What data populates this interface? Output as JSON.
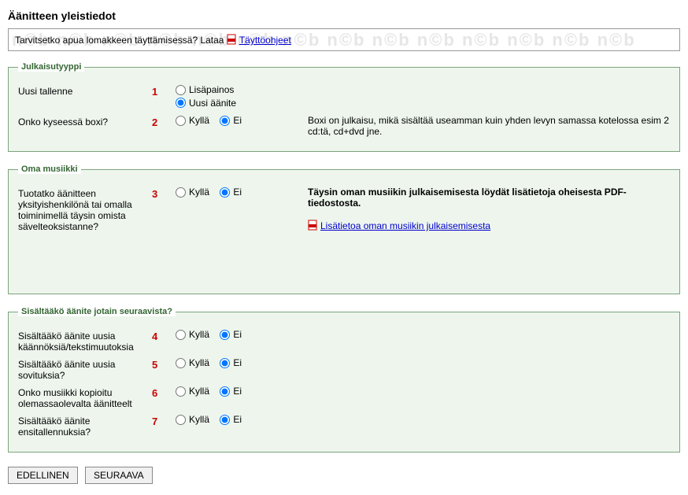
{
  "page_title": "Äänitteen yleistiedot",
  "help": {
    "prefix": "Tarvitsetko apua lomakkeen täyttämisessä? Lataa ",
    "link_label": "Täyttöohjeet",
    "watermark": "n©b n©b n©b n©b n©b n©b n©b n©b n©b n©b n©b n©b n©b n©b"
  },
  "sections": {
    "julkaisutyyppi": {
      "legend": "Julkaisutyyppi",
      "rows": [
        {
          "label": "Uusi tallenne",
          "num": "1",
          "options": [
            "Lisäpainos",
            "Uusi äänite"
          ],
          "selected": 1,
          "info": ""
        },
        {
          "label": "Onko kyseessä boxi?",
          "num": "2",
          "options": [
            "Kyllä",
            "Ei"
          ],
          "selected": 1,
          "info": "Boxi on julkaisu, mikä sisältää useamman kuin yhden levyn samassa kotelossa esim 2 cd:tä, cd+dvd jne."
        }
      ]
    },
    "oma_musiikki": {
      "legend": "Oma musiikki",
      "rows": [
        {
          "label": "Tuotatko äänitteen yksityishenkilönä tai omalla toiminimellä täysin omista sävelteoksistanne?",
          "num": "3",
          "options": [
            "Kyllä",
            "Ei"
          ],
          "selected": 1,
          "info_bold": "Täysin oman musiikin julkaisemisesta löydät lisätietoja oheisesta PDF-tiedostosta.",
          "link_label": "Lisätietoa oman musiikin julkaisemisesta"
        }
      ]
    },
    "sisaltaako": {
      "legend": "Sisältääkö äänite jotain seuraavista?",
      "rows": [
        {
          "label": "Sisältääkö äänite uusia käännöksiä/tekstimuutoksia",
          "num": "4",
          "options": [
            "Kyllä",
            "Ei"
          ],
          "selected": 1
        },
        {
          "label": "Sisältääkö äänite uusia sovituksia?",
          "num": "5",
          "options": [
            "Kyllä",
            "Ei"
          ],
          "selected": 1
        },
        {
          "label": "Onko musiikki kopioitu olemassaolevalta äänitteelt",
          "num": "6",
          "options": [
            "Kyllä",
            "Ei"
          ],
          "selected": 1
        },
        {
          "label": "Sisältääkö äänite ensitallennuksia?",
          "num": "7",
          "options": [
            "Kyllä",
            "Ei"
          ],
          "selected": 1
        }
      ]
    }
  },
  "buttons": {
    "prev": "EDELLINEN",
    "next": "SEURAAVA"
  }
}
